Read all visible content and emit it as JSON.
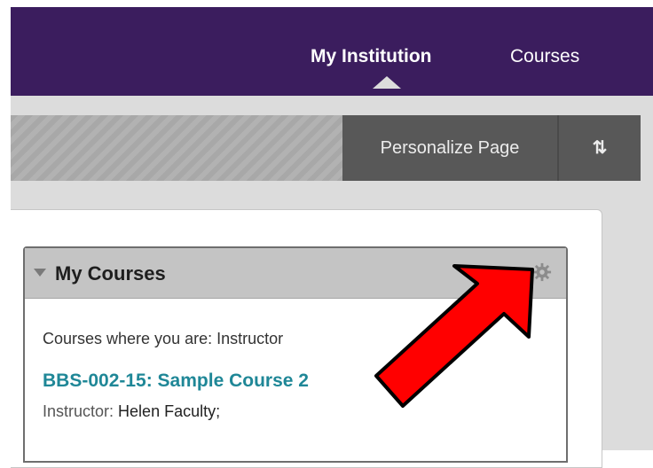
{
  "nav": {
    "items": [
      {
        "label": "My Institution",
        "active": true
      },
      {
        "label": "Courses",
        "active": false
      }
    ]
  },
  "toolbar": {
    "personalize_label": "Personalize Page",
    "reorder_icon": "sort-arrows-icon",
    "reorder_glyph": "⇅"
  },
  "module": {
    "title": "My Courses",
    "collapse_icon": "triangle-down-icon",
    "settings_icon": "gear-icon",
    "role_text": "Courses where you are: Instructor",
    "courses": [
      {
        "link_text": "BBS-002-15: Sample Course 2",
        "instructor_label": "Instructor:",
        "instructor_name": "Helen Faculty;"
      }
    ]
  },
  "annotation": {
    "icon": "red-arrow-icon",
    "color": "#ff0000"
  },
  "colors": {
    "nav_bg": "#3b1d5e",
    "link": "#1f8797",
    "toolbar_btn_bg": "#585858"
  }
}
